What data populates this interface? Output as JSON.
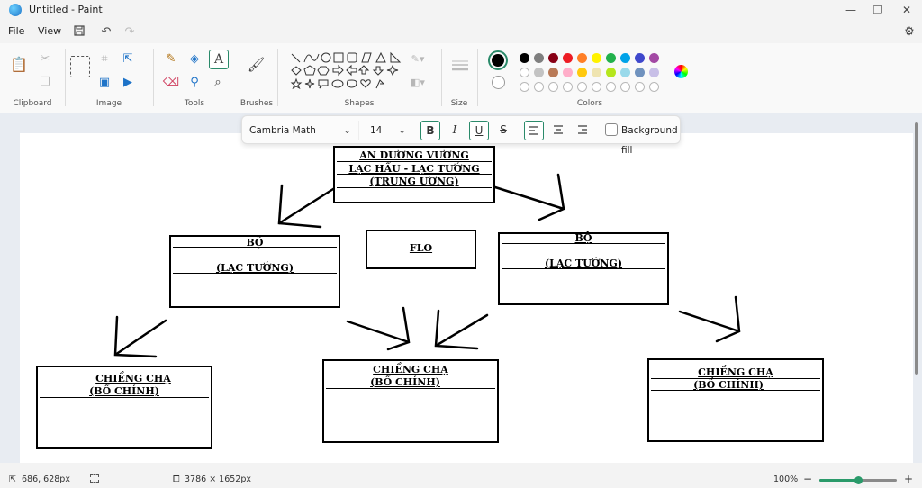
{
  "window": {
    "title": "Untitled - Paint",
    "minimize_glyph": "—",
    "maximize_glyph": "❐",
    "close_glyph": "✕"
  },
  "menu": {
    "file": "File",
    "view": "View"
  },
  "ribbon": {
    "clipboard": "Clipboard",
    "image": "Image",
    "tools": "Tools",
    "brushes": "Brushes",
    "shapes": "Shapes",
    "size": "Size",
    "colors": "Colors"
  },
  "colors": {
    "primary": "#000000",
    "secondary": "#ffffff",
    "palette_row1": [
      "#000000",
      "#7f7f7f",
      "#880015",
      "#ed1c24",
      "#ff7f27",
      "#fff200",
      "#22b14c",
      "#00a2e8",
      "#3f48cc",
      "#a349a4"
    ],
    "palette_row2": [
      "#ffffff",
      "#c3c3c3",
      "#b97a57",
      "#ffaec9",
      "#ffc90e",
      "#efe4b0",
      "#b5e61d",
      "#99d9ea",
      "#7092be",
      "#c8bfe7"
    ]
  },
  "text_toolbar": {
    "font": "Cambria Math",
    "size": "14",
    "bold": "B",
    "italic": "I",
    "underline": "U",
    "strike": "S",
    "background_fill": "Background fill"
  },
  "diagram": {
    "top_line1": "AN DƯƠNG VƯƠNG",
    "top_line2": "LẠC HẦU  -  LẠC TƯỚNG",
    "top_line3": "(TRUNG ƯƠNG)",
    "flo": "FLO",
    "left_bo": "BỘ",
    "left_lac": "(LẠC TƯỚNG)",
    "right_bo": "BỘ",
    "right_lac": "(LẠC TƯỚNG)",
    "c1_line1": "CHIỀNG CHẠ",
    "c1_line2": "(BỒ CHÍNH)",
    "c2_line1": "CHIỀNG CHẠ",
    "c2_line2": "(BỒ CHÍNH)",
    "c3_line1": "CHIỀNG CHẠ",
    "c3_line2": "(BỒ CHÍNH)"
  },
  "status": {
    "cursor": "686, 628px",
    "canvas_size": "3786 × 1652px",
    "zoom": "100%",
    "zoom_level": 0.5
  }
}
